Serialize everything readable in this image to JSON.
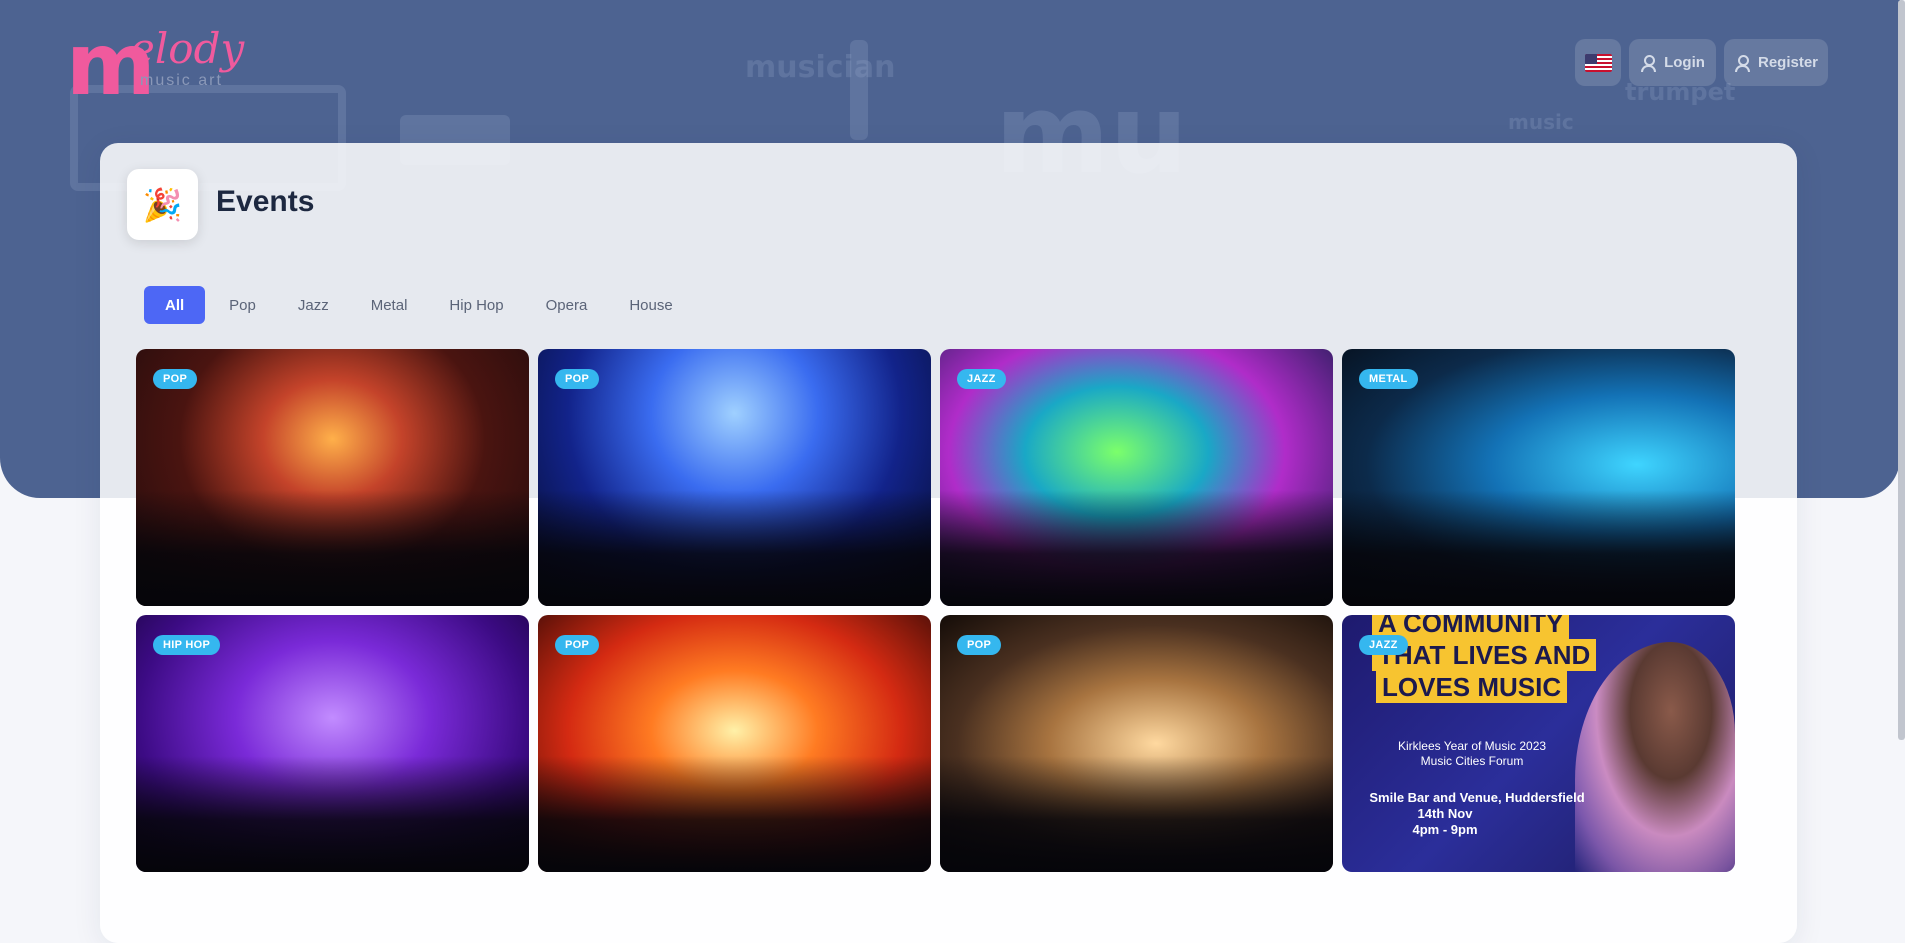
{
  "brand": {
    "logo_initial": "m",
    "logo_text": "elody",
    "logo_tagline": "music art"
  },
  "header": {
    "flag_icon": "us-flag-icon",
    "login_label": "Login",
    "register_label": "Register"
  },
  "events": {
    "title": "Events",
    "icon": "party-popper-icon",
    "filters": [
      "All",
      "Pop",
      "Jazz",
      "Metal",
      "Hip Hop",
      "Opera",
      "House"
    ],
    "active_filter": "All",
    "tiles": [
      {
        "genre": "POP"
      },
      {
        "genre": "POP"
      },
      {
        "genre": "JAZZ"
      },
      {
        "genre": "METAL"
      },
      {
        "genre": "HIP HOP"
      },
      {
        "genre": "POP"
      },
      {
        "genre": "POP"
      },
      {
        "genre": "JAZZ"
      }
    ],
    "poster": {
      "line1": "A COMMUNITY",
      "line2": "THAT LIVES AND",
      "line3": "LOVES MUSIC",
      "sub1": "Kirklees Year of Music 2023",
      "sub2": "Music Cities Forum",
      "venue": "Smile Bar and Venue, Huddersfield",
      "date": "14th Nov",
      "time": "4pm - 9pm"
    }
  },
  "colors": {
    "hero_bg": "#4d6391",
    "accent": "#4d67f5",
    "badge": "#35b7ef",
    "logo": "#f05a9d"
  }
}
